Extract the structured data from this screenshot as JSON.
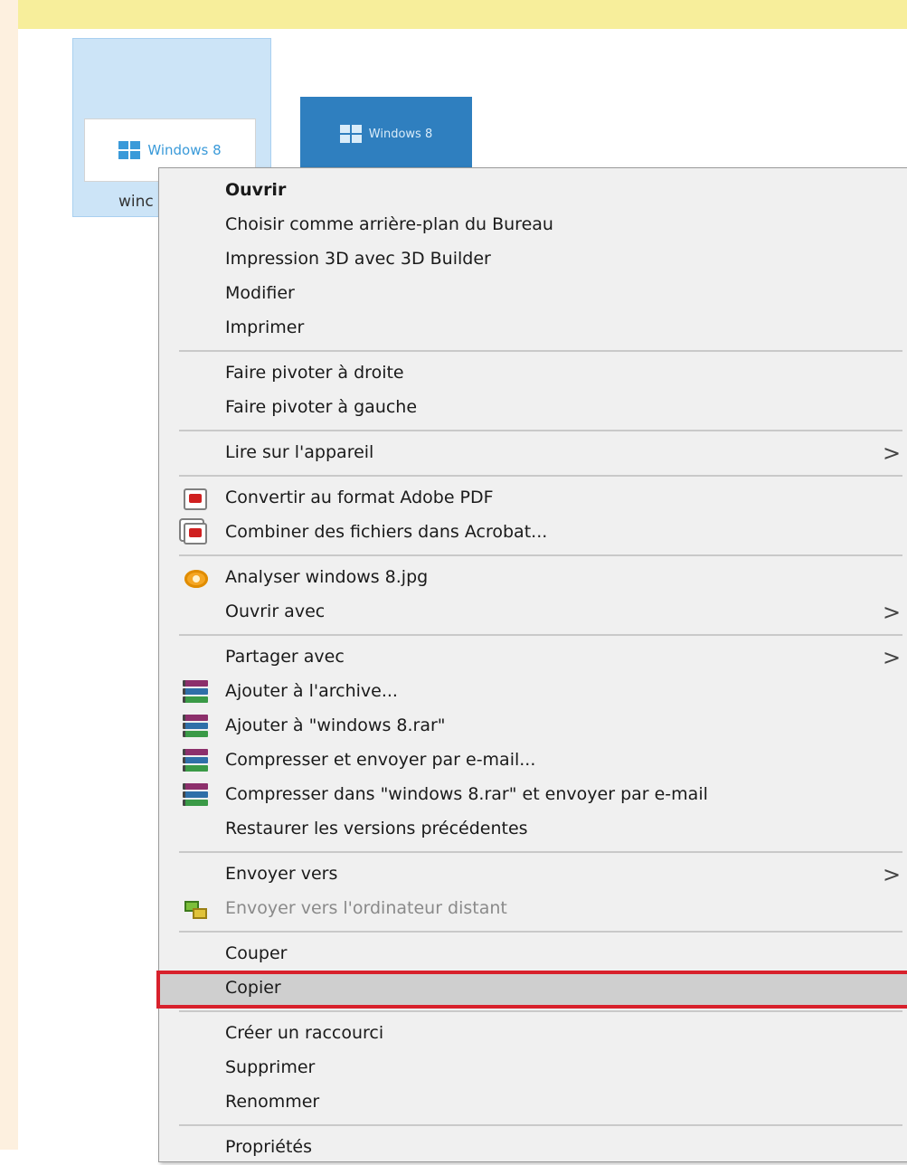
{
  "file_panel": {
    "files": [
      {
        "name_visible": "winc",
        "thumbnail_text": "Windows 8",
        "selected": true
      },
      {
        "thumbnail_text": "Windows 8",
        "selected": false
      }
    ]
  },
  "context_menu": {
    "groups": [
      [
        {
          "label": "Ouvrir",
          "bold": true
        },
        {
          "label": "Choisir comme arrière-plan du Bureau"
        },
        {
          "label": "Impression 3D avec 3D Builder"
        },
        {
          "label": "Modifier"
        },
        {
          "label": "Imprimer"
        }
      ],
      [
        {
          "label": "Faire pivoter à droite"
        },
        {
          "label": "Faire pivoter à gauche"
        }
      ],
      [
        {
          "label": "Lire sur l'appareil",
          "submenu": true
        }
      ],
      [
        {
          "label": "Convertir au format Adobe PDF",
          "icon": "pdf-icon"
        },
        {
          "label": "Combiner des fichiers dans Acrobat...",
          "icon": "pdf-combine-icon"
        }
      ],
      [
        {
          "label": "Analyser windows 8.jpg",
          "icon": "scan-eye-icon"
        },
        {
          "label": "Ouvrir avec",
          "submenu": true
        }
      ],
      [
        {
          "label": "Partager avec",
          "submenu": true
        },
        {
          "label": "Ajouter à l'archive...",
          "icon": "winrar-icon"
        },
        {
          "label": "Ajouter à \"windows 8.rar\"",
          "icon": "winrar-icon"
        },
        {
          "label": "Compresser et envoyer par e-mail...",
          "icon": "winrar-icon"
        },
        {
          "label": "Compresser dans \"windows 8.rar\" et envoyer par e-mail",
          "icon": "winrar-icon"
        },
        {
          "label": "Restaurer les versions précédentes"
        }
      ],
      [
        {
          "label": "Envoyer vers",
          "submenu": true
        },
        {
          "label": "Envoyer vers l'ordinateur distant",
          "icon": "remote-desktop-icon",
          "disabled": true
        }
      ],
      [
        {
          "label": "Couper"
        },
        {
          "label": "Copier",
          "highlighted": true
        }
      ],
      [
        {
          "label": "Créer un raccourci"
        },
        {
          "label": "Supprimer"
        },
        {
          "label": "Renommer"
        }
      ],
      [
        {
          "label": "Propriétés"
        }
      ]
    ],
    "submenu_arrow": ">",
    "highlight_color": "#d8212c"
  }
}
